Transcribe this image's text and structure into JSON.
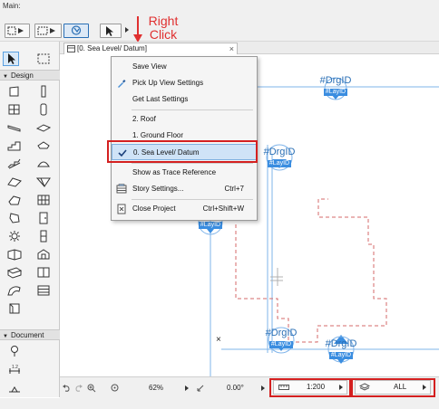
{
  "toolbar": {
    "title": "Main:"
  },
  "annotation": {
    "line1": "Right",
    "line2": "Click"
  },
  "toolbox": {
    "sections": [
      {
        "label": "Design"
      },
      {
        "label": "Document"
      }
    ]
  },
  "tab": {
    "label": "[0. Sea Level/ Datum]",
    "close": "×"
  },
  "context_menu": {
    "items": [
      {
        "label": "Save View",
        "shortcut": "",
        "icon": "",
        "checked": false
      },
      {
        "label": "Pick Up View Settings",
        "shortcut": "",
        "icon": "eyedropper-icon",
        "checked": false
      },
      {
        "label": "Get Last Settings",
        "shortcut": "",
        "icon": "",
        "checked": false
      },
      {
        "label": "2. Roof",
        "shortcut": "",
        "icon": "",
        "checked": false
      },
      {
        "label": "1. Ground Floor",
        "shortcut": "",
        "icon": "",
        "checked": false
      },
      {
        "label": "0. Sea Level/ Datum",
        "shortcut": "",
        "icon": "check-icon",
        "checked": true
      },
      {
        "label": "Show as Trace Reference",
        "shortcut": "",
        "icon": "",
        "checked": false
      },
      {
        "label": "Story Settings...",
        "shortcut": "Ctrl+7",
        "icon": "story-settings-icon",
        "checked": false
      },
      {
        "label": "Close Project",
        "shortcut": "Ctrl+Shift+W",
        "icon": "close-project-icon",
        "checked": false
      }
    ]
  },
  "canvas": {
    "markers": [
      {
        "title": "#DrgID",
        "sub": "#LayID"
      },
      {
        "title": "#DrgID",
        "sub": "#LayID"
      },
      {
        "title": "#DrgID",
        "sub": "#LayID"
      },
      {
        "title": "#DrgID",
        "sub": "#LayID"
      },
      {
        "title": "#DrgID",
        "sub": "#LayID"
      }
    ],
    "partial_marker_sub": "#LayID",
    "cross_mark": "×"
  },
  "statusbar": {
    "zoom": "62%",
    "angle": "0.00°",
    "scale": "1:200",
    "layers": "ALL"
  },
  "colors": {
    "accent": "#2a6fb5",
    "marker_blue": "#3a8de0",
    "highlight_red": "#d42020",
    "dashed_red": "#d46a6a",
    "menu_highlight": "#cfe3f7"
  }
}
